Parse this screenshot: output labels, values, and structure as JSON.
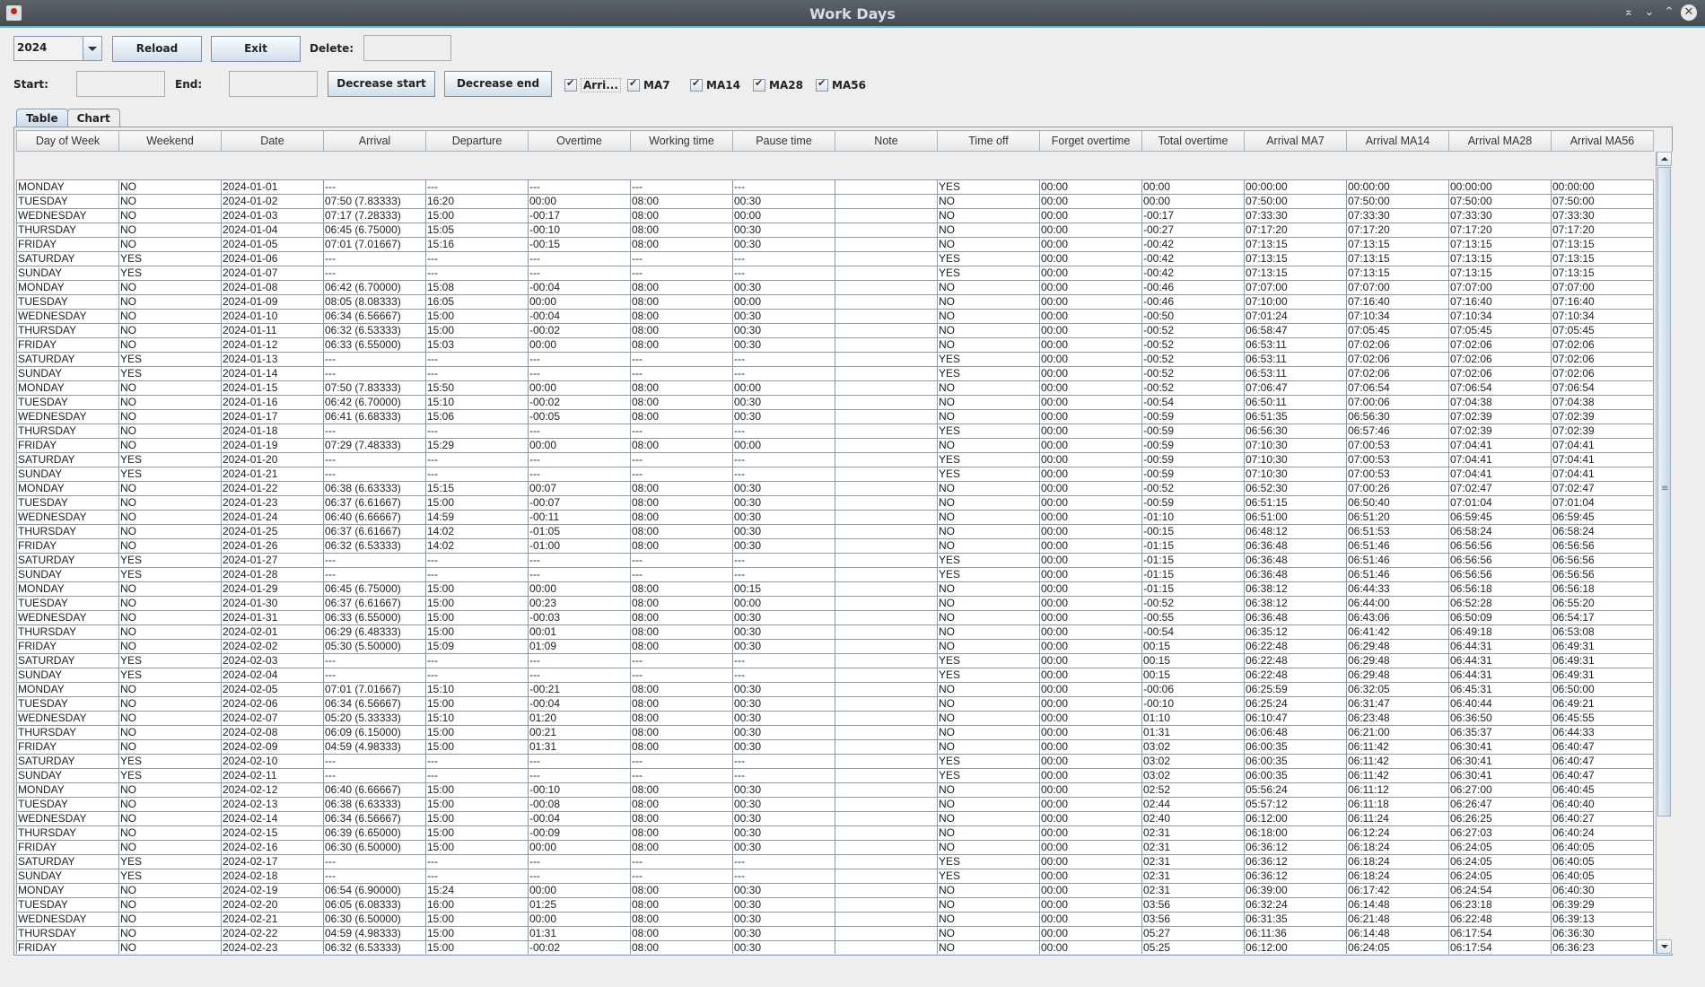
{
  "window": {
    "title": "Work Days"
  },
  "toolbar": {
    "year": "2024",
    "reload_label": "Reload",
    "exit_label": "Exit",
    "delete_label": "Delete:",
    "delete_value": "",
    "start_label": "Start:",
    "start_value": "",
    "end_label": "End:",
    "end_value": "",
    "decrease_start_label": "Decrease start",
    "decrease_end_label": "Decrease end",
    "checkboxes": [
      {
        "label": "Arri...",
        "checked": true
      },
      {
        "label": "MA7",
        "checked": true
      },
      {
        "label": "MA14",
        "checked": true
      },
      {
        "label": "MA28",
        "checked": true
      },
      {
        "label": "MA56",
        "checked": true
      }
    ]
  },
  "tabs": [
    {
      "label": "Table",
      "active": true
    },
    {
      "label": "Chart",
      "active": false
    }
  ],
  "table": {
    "columns": [
      "Day of Week",
      "Weekend",
      "Date",
      "Arrival",
      "Departure",
      "Overtime",
      "Working time",
      "Pause time",
      "Note",
      "Time off",
      "Forget overtime",
      "Total overtime",
      "Arrival MA7",
      "Arrival MA14",
      "Arrival MA28",
      "Arrival MA56"
    ],
    "rows": [
      [
        "MONDAY",
        "NO",
        "2024-01-01",
        "---",
        "---",
        "---",
        "---",
        "---",
        "",
        "YES",
        "00:00",
        "00:00",
        "00:00:00",
        "00:00:00",
        "00:00:00",
        "00:00:00"
      ],
      [
        "TUESDAY",
        "NO",
        "2024-01-02",
        "07:50 (7.83333)",
        "16:20",
        "00:00",
        "08:00",
        "00:30",
        "",
        "NO",
        "00:00",
        "00:00",
        "07:50:00",
        "07:50:00",
        "07:50:00",
        "07:50:00"
      ],
      [
        "WEDNESDAY",
        "NO",
        "2024-01-03",
        "07:17 (7.28333)",
        "15:00",
        "-00:17",
        "08:00",
        "00:00",
        "",
        "NO",
        "00:00",
        "-00:17",
        "07:33:30",
        "07:33:30",
        "07:33:30",
        "07:33:30"
      ],
      [
        "THURSDAY",
        "NO",
        "2024-01-04",
        "06:45 (6.75000)",
        "15:05",
        "-00:10",
        "08:00",
        "00:30",
        "",
        "NO",
        "00:00",
        "-00:27",
        "07:17:20",
        "07:17:20",
        "07:17:20",
        "07:17:20"
      ],
      [
        "FRIDAY",
        "NO",
        "2024-01-05",
        "07:01 (7.01667)",
        "15:16",
        "-00:15",
        "08:00",
        "00:30",
        "",
        "NO",
        "00:00",
        "-00:42",
        "07:13:15",
        "07:13:15",
        "07:13:15",
        "07:13:15"
      ],
      [
        "SATURDAY",
        "YES",
        "2024-01-06",
        "---",
        "---",
        "---",
        "---",
        "---",
        "",
        "YES",
        "00:00",
        "-00:42",
        "07:13:15",
        "07:13:15",
        "07:13:15",
        "07:13:15"
      ],
      [
        "SUNDAY",
        "YES",
        "2024-01-07",
        "---",
        "---",
        "---",
        "---",
        "---",
        "",
        "YES",
        "00:00",
        "-00:42",
        "07:13:15",
        "07:13:15",
        "07:13:15",
        "07:13:15"
      ],
      [
        "MONDAY",
        "NO",
        "2024-01-08",
        "06:42 (6.70000)",
        "15:08",
        "-00:04",
        "08:00",
        "00:30",
        "",
        "NO",
        "00:00",
        "-00:46",
        "07:07:00",
        "07:07:00",
        "07:07:00",
        "07:07:00"
      ],
      [
        "TUESDAY",
        "NO",
        "2024-01-09",
        "08:05 (8.08333)",
        "16:05",
        "00:00",
        "08:00",
        "00:00",
        "",
        "NO",
        "00:00",
        "-00:46",
        "07:10:00",
        "07:16:40",
        "07:16:40",
        "07:16:40"
      ],
      [
        "WEDNESDAY",
        "NO",
        "2024-01-10",
        "06:34 (6.56667)",
        "15:00",
        "-00:04",
        "08:00",
        "00:30",
        "",
        "NO",
        "00:00",
        "-00:50",
        "07:01:24",
        "07:10:34",
        "07:10:34",
        "07:10:34"
      ],
      [
        "THURSDAY",
        "NO",
        "2024-01-11",
        "06:32 (6.53333)",
        "15:00",
        "-00:02",
        "08:00",
        "00:30",
        "",
        "NO",
        "00:00",
        "-00:52",
        "06:58:47",
        "07:05:45",
        "07:05:45",
        "07:05:45"
      ],
      [
        "FRIDAY",
        "NO",
        "2024-01-12",
        "06:33 (6.55000)",
        "15:03",
        "00:00",
        "08:00",
        "00:30",
        "",
        "NO",
        "00:00",
        "-00:52",
        "06:53:11",
        "07:02:06",
        "07:02:06",
        "07:02:06"
      ],
      [
        "SATURDAY",
        "YES",
        "2024-01-13",
        "---",
        "---",
        "---",
        "---",
        "---",
        "",
        "YES",
        "00:00",
        "-00:52",
        "06:53:11",
        "07:02:06",
        "07:02:06",
        "07:02:06"
      ],
      [
        "SUNDAY",
        "YES",
        "2024-01-14",
        "---",
        "---",
        "---",
        "---",
        "---",
        "",
        "YES",
        "00:00",
        "-00:52",
        "06:53:11",
        "07:02:06",
        "07:02:06",
        "07:02:06"
      ],
      [
        "MONDAY",
        "NO",
        "2024-01-15",
        "07:50 (7.83333)",
        "15:50",
        "00:00",
        "08:00",
        "00:00",
        "",
        "NO",
        "00:00",
        "-00:52",
        "07:06:47",
        "07:06:54",
        "07:06:54",
        "07:06:54"
      ],
      [
        "TUESDAY",
        "NO",
        "2024-01-16",
        "06:42 (6.70000)",
        "15:10",
        "-00:02",
        "08:00",
        "00:30",
        "",
        "NO",
        "00:00",
        "-00:54",
        "06:50:11",
        "07:00:06",
        "07:04:38",
        "07:04:38"
      ],
      [
        "WEDNESDAY",
        "NO",
        "2024-01-17",
        "06:41 (6.68333)",
        "15:06",
        "-00:05",
        "08:00",
        "00:30",
        "",
        "NO",
        "00:00",
        "-00:59",
        "06:51:35",
        "06:56:30",
        "07:02:39",
        "07:02:39"
      ],
      [
        "THURSDAY",
        "NO",
        "2024-01-18",
        "---",
        "---",
        "---",
        "---",
        "---",
        "",
        "YES",
        "00:00",
        "-00:59",
        "06:56:30",
        "06:57:46",
        "07:02:39",
        "07:02:39"
      ],
      [
        "FRIDAY",
        "NO",
        "2024-01-19",
        "07:29 (7.48333)",
        "15:29",
        "00:00",
        "08:00",
        "00:00",
        "",
        "NO",
        "00:00",
        "-00:59",
        "07:10:30",
        "07:00:53",
        "07:04:41",
        "07:04:41"
      ],
      [
        "SATURDAY",
        "YES",
        "2024-01-20",
        "---",
        "---",
        "---",
        "---",
        "---",
        "",
        "YES",
        "00:00",
        "-00:59",
        "07:10:30",
        "07:00:53",
        "07:04:41",
        "07:04:41"
      ],
      [
        "SUNDAY",
        "YES",
        "2024-01-21",
        "---",
        "---",
        "---",
        "---",
        "---",
        "",
        "YES",
        "00:00",
        "-00:59",
        "07:10:30",
        "07:00:53",
        "07:04:41",
        "07:04:41"
      ],
      [
        "MONDAY",
        "NO",
        "2024-01-22",
        "06:38 (6.63333)",
        "15:15",
        "00:07",
        "08:00",
        "00:30",
        "",
        "NO",
        "00:00",
        "-00:52",
        "06:52:30",
        "07:00:26",
        "07:02:47",
        "07:02:47"
      ],
      [
        "TUESDAY",
        "NO",
        "2024-01-23",
        "06:37 (6.61667)",
        "15:00",
        "-00:07",
        "08:00",
        "00:30",
        "",
        "NO",
        "00:00",
        "-00:59",
        "06:51:15",
        "06:50:40",
        "07:01:04",
        "07:01:04"
      ],
      [
        "WEDNESDAY",
        "NO",
        "2024-01-24",
        "06:40 (6.66667)",
        "14:59",
        "-00:11",
        "08:00",
        "00:30",
        "",
        "NO",
        "00:00",
        "-01:10",
        "06:51:00",
        "06:51:20",
        "06:59:45",
        "06:59:45"
      ],
      [
        "THURSDAY",
        "NO",
        "2024-01-25",
        "06:37 (6.61667)",
        "14:02",
        "-01:05",
        "08:00",
        "00:30",
        "",
        "NO",
        "00:00",
        "-00:15",
        "06:48:12",
        "06:51:53",
        "06:58:24",
        "06:58:24"
      ],
      [
        "FRIDAY",
        "NO",
        "2024-01-26",
        "06:32 (6.53333)",
        "14:02",
        "-01:00",
        "08:00",
        "00:30",
        "",
        "NO",
        "00:00",
        "-01:15",
        "06:36:48",
        "06:51:46",
        "06:56:56",
        "06:56:56"
      ],
      [
        "SATURDAY",
        "YES",
        "2024-01-27",
        "---",
        "---",
        "---",
        "---",
        "---",
        "",
        "YES",
        "00:00",
        "-01:15",
        "06:36:48",
        "06:51:46",
        "06:56:56",
        "06:56:56"
      ],
      [
        "SUNDAY",
        "YES",
        "2024-01-28",
        "---",
        "---",
        "---",
        "---",
        "---",
        "",
        "YES",
        "00:00",
        "-01:15",
        "06:36:48",
        "06:51:46",
        "06:56:56",
        "06:56:56"
      ],
      [
        "MONDAY",
        "NO",
        "2024-01-29",
        "06:45 (6.75000)",
        "15:00",
        "00:00",
        "08:00",
        "00:15",
        "",
        "NO",
        "00:00",
        "-01:15",
        "06:38:12",
        "06:44:33",
        "06:56:18",
        "06:56:18"
      ],
      [
        "TUESDAY",
        "NO",
        "2024-01-30",
        "06:37 (6.61667)",
        "15:00",
        "00:23",
        "08:00",
        "00:00",
        "",
        "NO",
        "00:00",
        "-00:52",
        "06:38:12",
        "06:44:00",
        "06:52:28",
        "06:55:20"
      ],
      [
        "WEDNESDAY",
        "NO",
        "2024-01-31",
        "06:33 (6.55000)",
        "15:00",
        "-00:03",
        "08:00",
        "00:30",
        "",
        "NO",
        "00:00",
        "-00:55",
        "06:36:48",
        "06:43:06",
        "06:50:09",
        "06:54:17"
      ],
      [
        "THURSDAY",
        "NO",
        "2024-02-01",
        "06:29 (6.48333)",
        "15:00",
        "00:01",
        "08:00",
        "00:30",
        "",
        "NO",
        "00:00",
        "-00:54",
        "06:35:12",
        "06:41:42",
        "06:49:18",
        "06:53:08"
      ],
      [
        "FRIDAY",
        "NO",
        "2024-02-02",
        "05:30 (5.50000)",
        "15:09",
        "01:09",
        "08:00",
        "00:30",
        "",
        "NO",
        "00:00",
        "00:15",
        "06:22:48",
        "06:29:48",
        "06:44:31",
        "06:49:31"
      ],
      [
        "SATURDAY",
        "YES",
        "2024-02-03",
        "---",
        "---",
        "---",
        "---",
        "---",
        "",
        "YES",
        "00:00",
        "00:15",
        "06:22:48",
        "06:29:48",
        "06:44:31",
        "06:49:31"
      ],
      [
        "SUNDAY",
        "YES",
        "2024-02-04",
        "---",
        "---",
        "---",
        "---",
        "---",
        "",
        "YES",
        "00:00",
        "00:15",
        "06:22:48",
        "06:29:48",
        "06:44:31",
        "06:49:31"
      ],
      [
        "MONDAY",
        "NO",
        "2024-02-05",
        "07:01 (7.01667)",
        "15:10",
        "-00:21",
        "08:00",
        "00:30",
        "",
        "NO",
        "00:00",
        "-00:06",
        "06:25:59",
        "06:32:05",
        "06:45:31",
        "06:50:00"
      ],
      [
        "TUESDAY",
        "NO",
        "2024-02-06",
        "06:34 (6.56667)",
        "15:00",
        "-00:04",
        "08:00",
        "00:30",
        "",
        "NO",
        "00:00",
        "-00:10",
        "06:25:24",
        "06:31:47",
        "06:40:44",
        "06:49:21"
      ],
      [
        "WEDNESDAY",
        "NO",
        "2024-02-07",
        "05:20 (5.33333)",
        "15:10",
        "01:20",
        "08:00",
        "00:30",
        "",
        "NO",
        "00:00",
        "01:10",
        "06:10:47",
        "06:23:48",
        "06:36:50",
        "06:45:55"
      ],
      [
        "THURSDAY",
        "NO",
        "2024-02-08",
        "06:09 (6.15000)",
        "15:00",
        "00:21",
        "08:00",
        "00:30",
        "",
        "NO",
        "00:00",
        "01:31",
        "06:06:48",
        "06:21:00",
        "06:35:37",
        "06:44:33"
      ],
      [
        "FRIDAY",
        "NO",
        "2024-02-09",
        "04:59 (4.98333)",
        "15:00",
        "01:31",
        "08:00",
        "00:30",
        "",
        "NO",
        "00:00",
        "03:02",
        "06:00:35",
        "06:11:42",
        "06:30:41",
        "06:40:47"
      ],
      [
        "SATURDAY",
        "YES",
        "2024-02-10",
        "---",
        "---",
        "---",
        "---",
        "---",
        "",
        "YES",
        "00:00",
        "03:02",
        "06:00:35",
        "06:11:42",
        "06:30:41",
        "06:40:47"
      ],
      [
        "SUNDAY",
        "YES",
        "2024-02-11",
        "---",
        "---",
        "---",
        "---",
        "---",
        "",
        "YES",
        "00:00",
        "03:02",
        "06:00:35",
        "06:11:42",
        "06:30:41",
        "06:40:47"
      ],
      [
        "MONDAY",
        "NO",
        "2024-02-12",
        "06:40 (6.66667)",
        "15:00",
        "-00:10",
        "08:00",
        "00:30",
        "",
        "NO",
        "00:00",
        "02:52",
        "05:56:24",
        "06:11:12",
        "06:27:00",
        "06:40:45"
      ],
      [
        "TUESDAY",
        "NO",
        "2024-02-13",
        "06:38 (6.63333)",
        "15:00",
        "-00:08",
        "08:00",
        "00:30",
        "",
        "NO",
        "00:00",
        "02:44",
        "05:57:12",
        "06:11:18",
        "06:26:47",
        "06:40:40"
      ],
      [
        "WEDNESDAY",
        "NO",
        "2024-02-14",
        "06:34 (6.56667)",
        "15:00",
        "-00:04",
        "08:00",
        "00:30",
        "",
        "NO",
        "00:00",
        "02:40",
        "06:12:00",
        "06:11:24",
        "06:26:25",
        "06:40:27"
      ],
      [
        "THURSDAY",
        "NO",
        "2024-02-15",
        "06:39 (6.65000)",
        "15:00",
        "-00:09",
        "08:00",
        "00:30",
        "",
        "NO",
        "00:00",
        "02:31",
        "06:18:00",
        "06:12:24",
        "06:27:03",
        "06:40:24"
      ],
      [
        "FRIDAY",
        "NO",
        "2024-02-16",
        "06:30 (6.50000)",
        "15:00",
        "00:00",
        "08:00",
        "00:30",
        "",
        "NO",
        "00:00",
        "02:31",
        "06:36:12",
        "06:18:24",
        "06:24:05",
        "06:40:05"
      ],
      [
        "SATURDAY",
        "YES",
        "2024-02-17",
        "---",
        "---",
        "---",
        "---",
        "---",
        "",
        "YES",
        "00:00",
        "02:31",
        "06:36:12",
        "06:18:24",
        "06:24:05",
        "06:40:05"
      ],
      [
        "SUNDAY",
        "YES",
        "2024-02-18",
        "---",
        "---",
        "---",
        "---",
        "---",
        "",
        "YES",
        "00:00",
        "02:31",
        "06:36:12",
        "06:18:24",
        "06:24:05",
        "06:40:05"
      ],
      [
        "MONDAY",
        "NO",
        "2024-02-19",
        "06:54 (6.90000)",
        "15:24",
        "00:00",
        "08:00",
        "00:30",
        "",
        "NO",
        "00:00",
        "02:31",
        "06:39:00",
        "06:17:42",
        "06:24:54",
        "06:40:30"
      ],
      [
        "TUESDAY",
        "NO",
        "2024-02-20",
        "06:05 (6.08333)",
        "16:00",
        "01:25",
        "08:00",
        "00:30",
        "",
        "NO",
        "00:00",
        "03:56",
        "06:32:24",
        "06:14:48",
        "06:23:18",
        "06:39:29"
      ],
      [
        "WEDNESDAY",
        "NO",
        "2024-02-21",
        "06:30 (6.50000)",
        "15:00",
        "00:00",
        "08:00",
        "00:30",
        "",
        "NO",
        "00:00",
        "03:56",
        "06:31:35",
        "06:21:48",
        "06:22:48",
        "06:39:13"
      ],
      [
        "THURSDAY",
        "NO",
        "2024-02-22",
        "04:59 (4.98333)",
        "15:00",
        "01:31",
        "08:00",
        "00:30",
        "",
        "NO",
        "00:00",
        "05:27",
        "06:11:36",
        "06:14:48",
        "06:17:54",
        "06:36:30"
      ],
      [
        "FRIDAY",
        "NO",
        "2024-02-23",
        "06:32 (6.53333)",
        "15:00",
        "-00:02",
        "08:00",
        "00:30",
        "",
        "NO",
        "00:00",
        "05:25",
        "06:12:00",
        "06:24:05",
        "06:17:54",
        "06:36:23"
      ]
    ]
  }
}
